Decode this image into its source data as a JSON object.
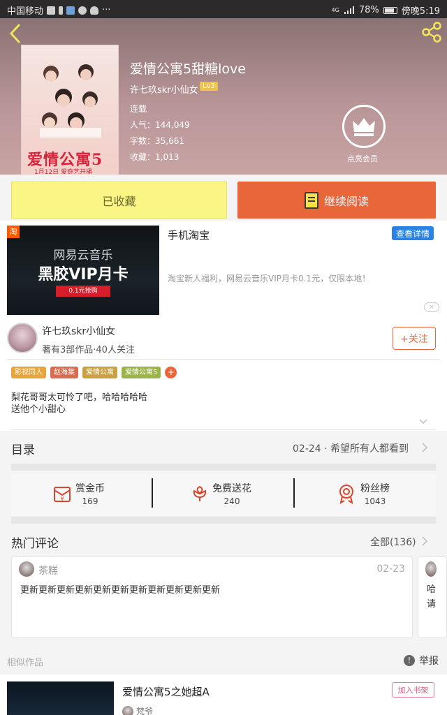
{
  "status_bar": {
    "carrier": "中国移动",
    "battery": "78%",
    "time": "傍晚5:19",
    "network": "4G"
  },
  "book": {
    "cover_title": "爱情公寓5",
    "cover_subtitle": "1月12日 爱奇艺开播",
    "title": "爱情公寓5甜糖love",
    "author": "许七玖skr小仙女",
    "level": "Lv3",
    "status": "连载",
    "popularity": "人气：144,049",
    "words": "字数：35,661",
    "favorites": "收藏：1,013",
    "vip_label": "点亮会员"
  },
  "actions": {
    "collected": "已收藏",
    "continue": "继续阅读"
  },
  "ad": {
    "image_line1": "网易云音乐",
    "image_line2": "黑胶VIP月卡",
    "image_line3": "0.1元抢购",
    "source_badge": "淘",
    "title": "手机淘宝",
    "detail_button": "查看详情",
    "description": "淘宝新人福利，网易云音乐VIP月卡0.1元，仅限本地！",
    "close": "×"
  },
  "author_card": {
    "name": "许七玖skr小仙女",
    "summary": "著有3部作品·40人关注",
    "follow": "+关注"
  },
  "tags": [
    {
      "label": "影视同人",
      "color": "#e9a53a"
    },
    {
      "label": "赵海棠",
      "color": "#d96b4f"
    },
    {
      "label": "爱情公寓",
      "color": "#c9a042"
    },
    {
      "label": "爱情公寓5",
      "color": "#9bb44a"
    }
  ],
  "tag_more": "+",
  "intro": {
    "line1": "梨花哥哥太可怜了吧，哈哈哈哈哈",
    "line2": "送他个小甜心"
  },
  "catalog": {
    "title": "目录",
    "latest": "02-24 · 希望所有人都看到"
  },
  "stats": [
    {
      "label": "赏金币",
      "value": "169",
      "icon": "red-envelope-icon"
    },
    {
      "label": "免费送花",
      "value": "240",
      "icon": "flower-icon"
    },
    {
      "label": "粉丝榜",
      "value": "1043",
      "icon": "medal-icon"
    }
  ],
  "comments": {
    "title": "热门评论",
    "all": "全部(136)",
    "items": [
      {
        "user": "茶糕",
        "date": "02-23",
        "text": "更新更新更新更新更新更新更新更新更新更新更新"
      }
    ],
    "peek_line1": "哈",
    "peek_line2": "请"
  },
  "similar": {
    "title": "相似作品",
    "report": "举报",
    "items": [
      {
        "title": "爱情公寓5之她超A",
        "author": "梵爷",
        "add": "加入书架"
      }
    ]
  },
  "colors": {
    "accent_orange": "#e8663a",
    "collected_yellow": "#fbf585",
    "detail_blue": "#2a82e4"
  }
}
